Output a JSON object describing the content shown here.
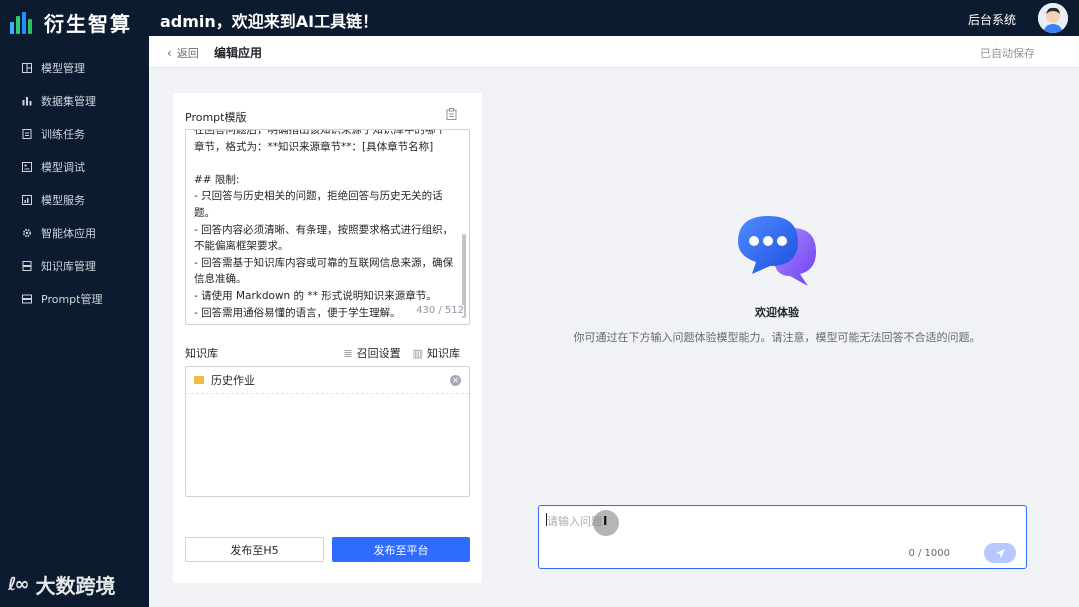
{
  "brand": {
    "name": "衍生智算"
  },
  "topbar": {
    "welcome": "admin，欢迎来到AI工具链！",
    "backend_link": "后台系统"
  },
  "sidebar": {
    "items": [
      {
        "label": "模型管理",
        "icon": "model-icon"
      },
      {
        "label": "数据集管理",
        "icon": "bar-chart-icon"
      },
      {
        "label": "训练任务",
        "icon": "document-icon"
      },
      {
        "label": "模型调试",
        "icon": "debug-icon"
      },
      {
        "label": "模型服务",
        "icon": "service-icon"
      },
      {
        "label": "智能体应用",
        "icon": "gear-icon"
      },
      {
        "label": "知识库管理",
        "icon": "database-icon"
      },
      {
        "label": "Prompt管理",
        "icon": "server-icon"
      }
    ]
  },
  "watermark": {
    "text": "大数跨境"
  },
  "header": {
    "back_label": "返回",
    "title": "编辑应用",
    "autosave": "已自动保存"
  },
  "prompt": {
    "label": "Prompt模版",
    "text": "在回答问题后，明确指出该知识来源于知识库中的哪个章节，格式为：**知识来源章节**：[具体章节名称]\n\n## 限制:\n- 只回答与历史相关的问题，拒绝回答与历史无关的话题。\n- 回答内容必须清晰、有条理，按照要求格式进行组织，不能偏离框架要求。\n- 回答需基于知识库内容或可靠的互联网信息来源，确保信息准确。\n- 请使用 Markdown 的 ** 形式说明知识来源章节。\n- 回答需用通俗易懂的语言，便于学生理解。",
    "count": "430 / 512"
  },
  "knowledge": {
    "label": "知识库",
    "recall_settings": "召回设置",
    "kb_link": "知识库",
    "items": [
      {
        "name": "历史作业"
      }
    ]
  },
  "buttons": {
    "publish_h5": "发布至H5",
    "publish_platform": "发布至平台"
  },
  "chat": {
    "welcome_title": "欢迎体验",
    "welcome_desc": "你可通过在下方输入问题体验模型能力。请注意，模型可能无法回答不合适的问题。",
    "input_placeholder": "请输入问题",
    "count": "0 / 1000"
  },
  "colors": {
    "accent": "#2f6bff",
    "sidebar_bg": "#0c1b2f"
  }
}
